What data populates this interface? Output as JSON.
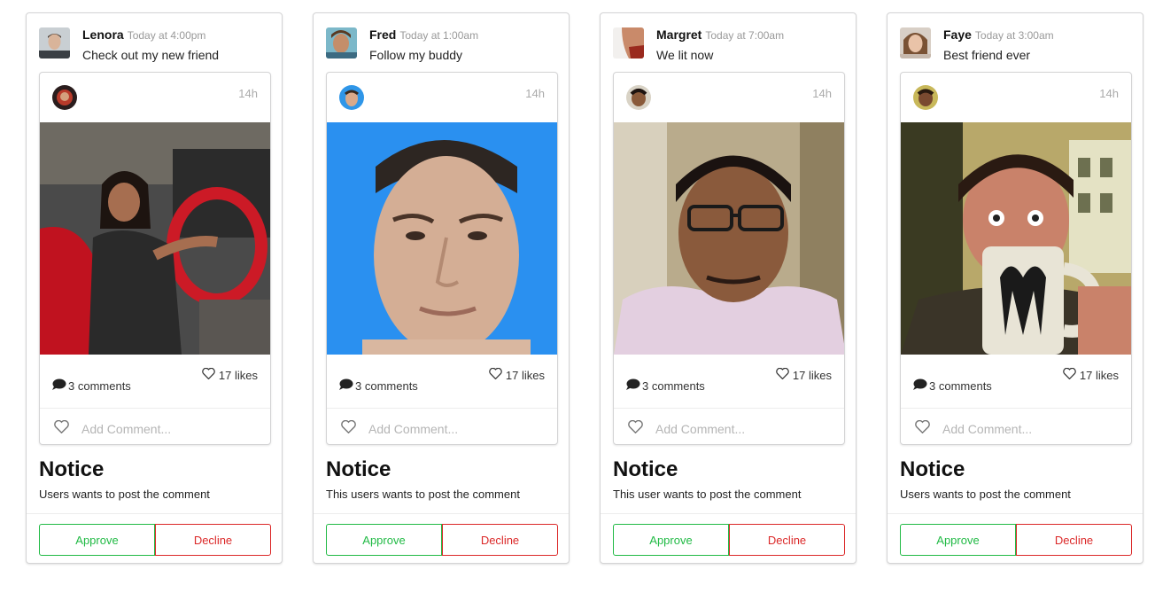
{
  "colors": {
    "approve": "#21ba45",
    "decline": "#db2828",
    "muted": "#999999"
  },
  "cards": [
    {
      "user": "Lenora",
      "date": "Today at 4:00pm",
      "message": "Check out my new friend",
      "post_time": "14h",
      "comments": "3 comments",
      "likes": "17 likes",
      "comment_placeholder": "Add Comment...",
      "notice_title": "Notice",
      "notice_text": "Users wants to post the comment",
      "approve_label": "Approve",
      "decline_label": "Decline",
      "icons": {
        "comment": "comment-icon",
        "like": "heart-outline-icon"
      }
    },
    {
      "user": "Fred",
      "date": "Today at 1:00am",
      "message": "Follow my buddy",
      "post_time": "14h",
      "comments": "3 comments",
      "likes": "17 likes",
      "comment_placeholder": "Add Comment...",
      "notice_title": "Notice",
      "notice_text": "This users wants to post the comment",
      "approve_label": "Approve",
      "decline_label": "Decline",
      "icons": {
        "comment": "comment-icon",
        "like": "heart-outline-icon"
      }
    },
    {
      "user": "Margret",
      "date": "Today at 7:00am",
      "message": "We lit now",
      "post_time": "14h",
      "comments": "3 comments",
      "likes": "17 likes",
      "comment_placeholder": "Add Comment...",
      "notice_title": "Notice",
      "notice_text": "This user wants to post the comment",
      "approve_label": "Approve",
      "decline_label": "Decline",
      "icons": {
        "comment": "comment-icon",
        "like": "heart-outline-icon"
      }
    },
    {
      "user": "Faye",
      "date": "Today at 3:00am",
      "message": "Best friend ever",
      "post_time": "14h",
      "comments": "3 comments",
      "likes": "17 likes",
      "comment_placeholder": "Add Comment...",
      "notice_title": "Notice",
      "notice_text": "Users wants to post the comment",
      "approve_label": "Approve",
      "decline_label": "Decline",
      "icons": {
        "comment": "comment-icon",
        "like": "heart-outline-icon"
      }
    }
  ]
}
